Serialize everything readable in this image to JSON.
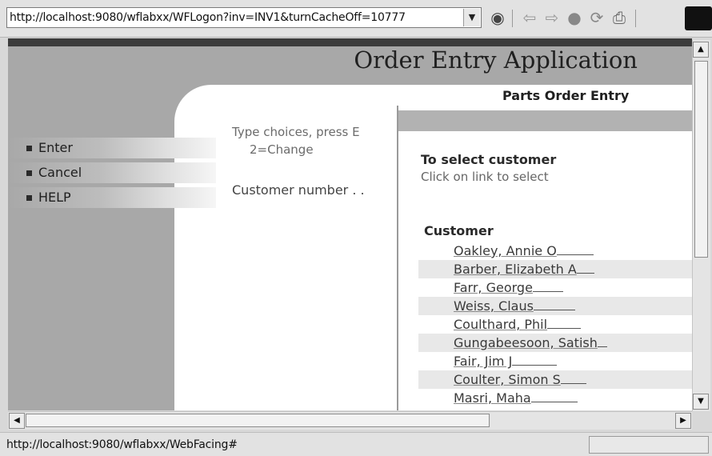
{
  "browser": {
    "url": "http://localhost:9080/wflabxx/WFLogon?inv=INV1&turnCacheOff=10777",
    "toolbar_icons": [
      "go-icon",
      "back-icon",
      "forward-icon",
      "stop-icon",
      "refresh-icon",
      "print-icon"
    ]
  },
  "app": {
    "title": "Order Entry Application",
    "subtitle": "Parts Order Entry"
  },
  "menu": [
    {
      "label": "Enter"
    },
    {
      "label": "Cancel"
    },
    {
      "label": "HELP"
    }
  ],
  "form": {
    "instruction_line1": "Type choices, press E",
    "instruction_line2": "2=Change",
    "customer_number_label": "Customer number . ."
  },
  "popup": {
    "heading": "To select customer",
    "subheading": "Click on link to select",
    "column_label": "Customer",
    "customers": [
      "Oakley, Annie O",
      "Barber, Elizabeth A",
      "Farr, George",
      "Weiss, Claus",
      "Coulthard, Phil",
      "Gungabeesoon, Satish",
      "Fair, Jim J",
      "Coulter, Simon S",
      "Masri, Maha"
    ]
  },
  "status_bar": {
    "text": "http://localhost:9080/wflabxx/WebFacing#"
  },
  "colors": {
    "page_gray": "#a8a8a8",
    "top_band": "#3c3c3c",
    "row_alt": "#e8e8e8"
  }
}
